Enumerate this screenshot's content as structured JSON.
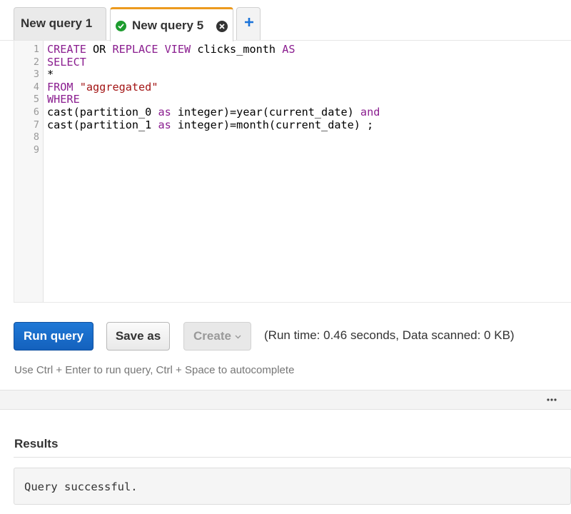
{
  "tabs": [
    {
      "label": "New query 1",
      "active": false
    },
    {
      "label": "New query 5",
      "active": true,
      "status_icon": "check-circle-icon",
      "close_icon": "close-icon"
    }
  ],
  "add_tab_icon": "plus-icon",
  "editor": {
    "line_numbers": [
      "1",
      "2",
      "3",
      "4",
      "5",
      "6",
      "7",
      "8",
      "9"
    ],
    "lines": [
      [
        {
          "t": "CREATE",
          "k": "kw"
        },
        {
          "t": " OR ",
          "k": ""
        },
        {
          "t": "REPLACE VIEW",
          "k": "kw"
        },
        {
          "t": " clicks_month ",
          "k": ""
        },
        {
          "t": "AS",
          "k": "kw"
        }
      ],
      [
        {
          "t": "SELECT",
          "k": "kw"
        }
      ],
      [
        {
          "t": "*",
          "k": ""
        }
      ],
      [
        {
          "t": "FROM",
          "k": "kw"
        },
        {
          "t": " ",
          "k": ""
        },
        {
          "t": "\"aggregated\"",
          "k": "str"
        }
      ],
      [
        {
          "t": "WHERE",
          "k": "kw"
        }
      ],
      [
        {
          "t": "cast(partition_0 ",
          "k": ""
        },
        {
          "t": "as",
          "k": "kw"
        },
        {
          "t": " integer)=year(current_date) ",
          "k": ""
        },
        {
          "t": "and",
          "k": "kw"
        }
      ],
      [
        {
          "t": "cast(partition_1 ",
          "k": ""
        },
        {
          "t": "as",
          "k": "kw"
        },
        {
          "t": " integer)=month(current_date) ;",
          "k": ""
        }
      ],
      [],
      []
    ]
  },
  "toolbar": {
    "run_label": "Run query",
    "save_label": "Save as",
    "create_label": "Create",
    "runtime_text": "(Run time: 0.46 seconds, Data scanned: 0 KB)"
  },
  "hint": "Use Ctrl + Enter to run query, Ctrl + Space to autocomplete",
  "more_icon": "ellipsis-icon",
  "results": {
    "title": "Results",
    "message": "Query successful."
  },
  "colors": {
    "active_tab_accent": "#ec9a1e",
    "primary_button": "#1f6fd0",
    "keyword": "#8a1d8f",
    "string": "#a31515",
    "success": "#1d9c2e"
  }
}
